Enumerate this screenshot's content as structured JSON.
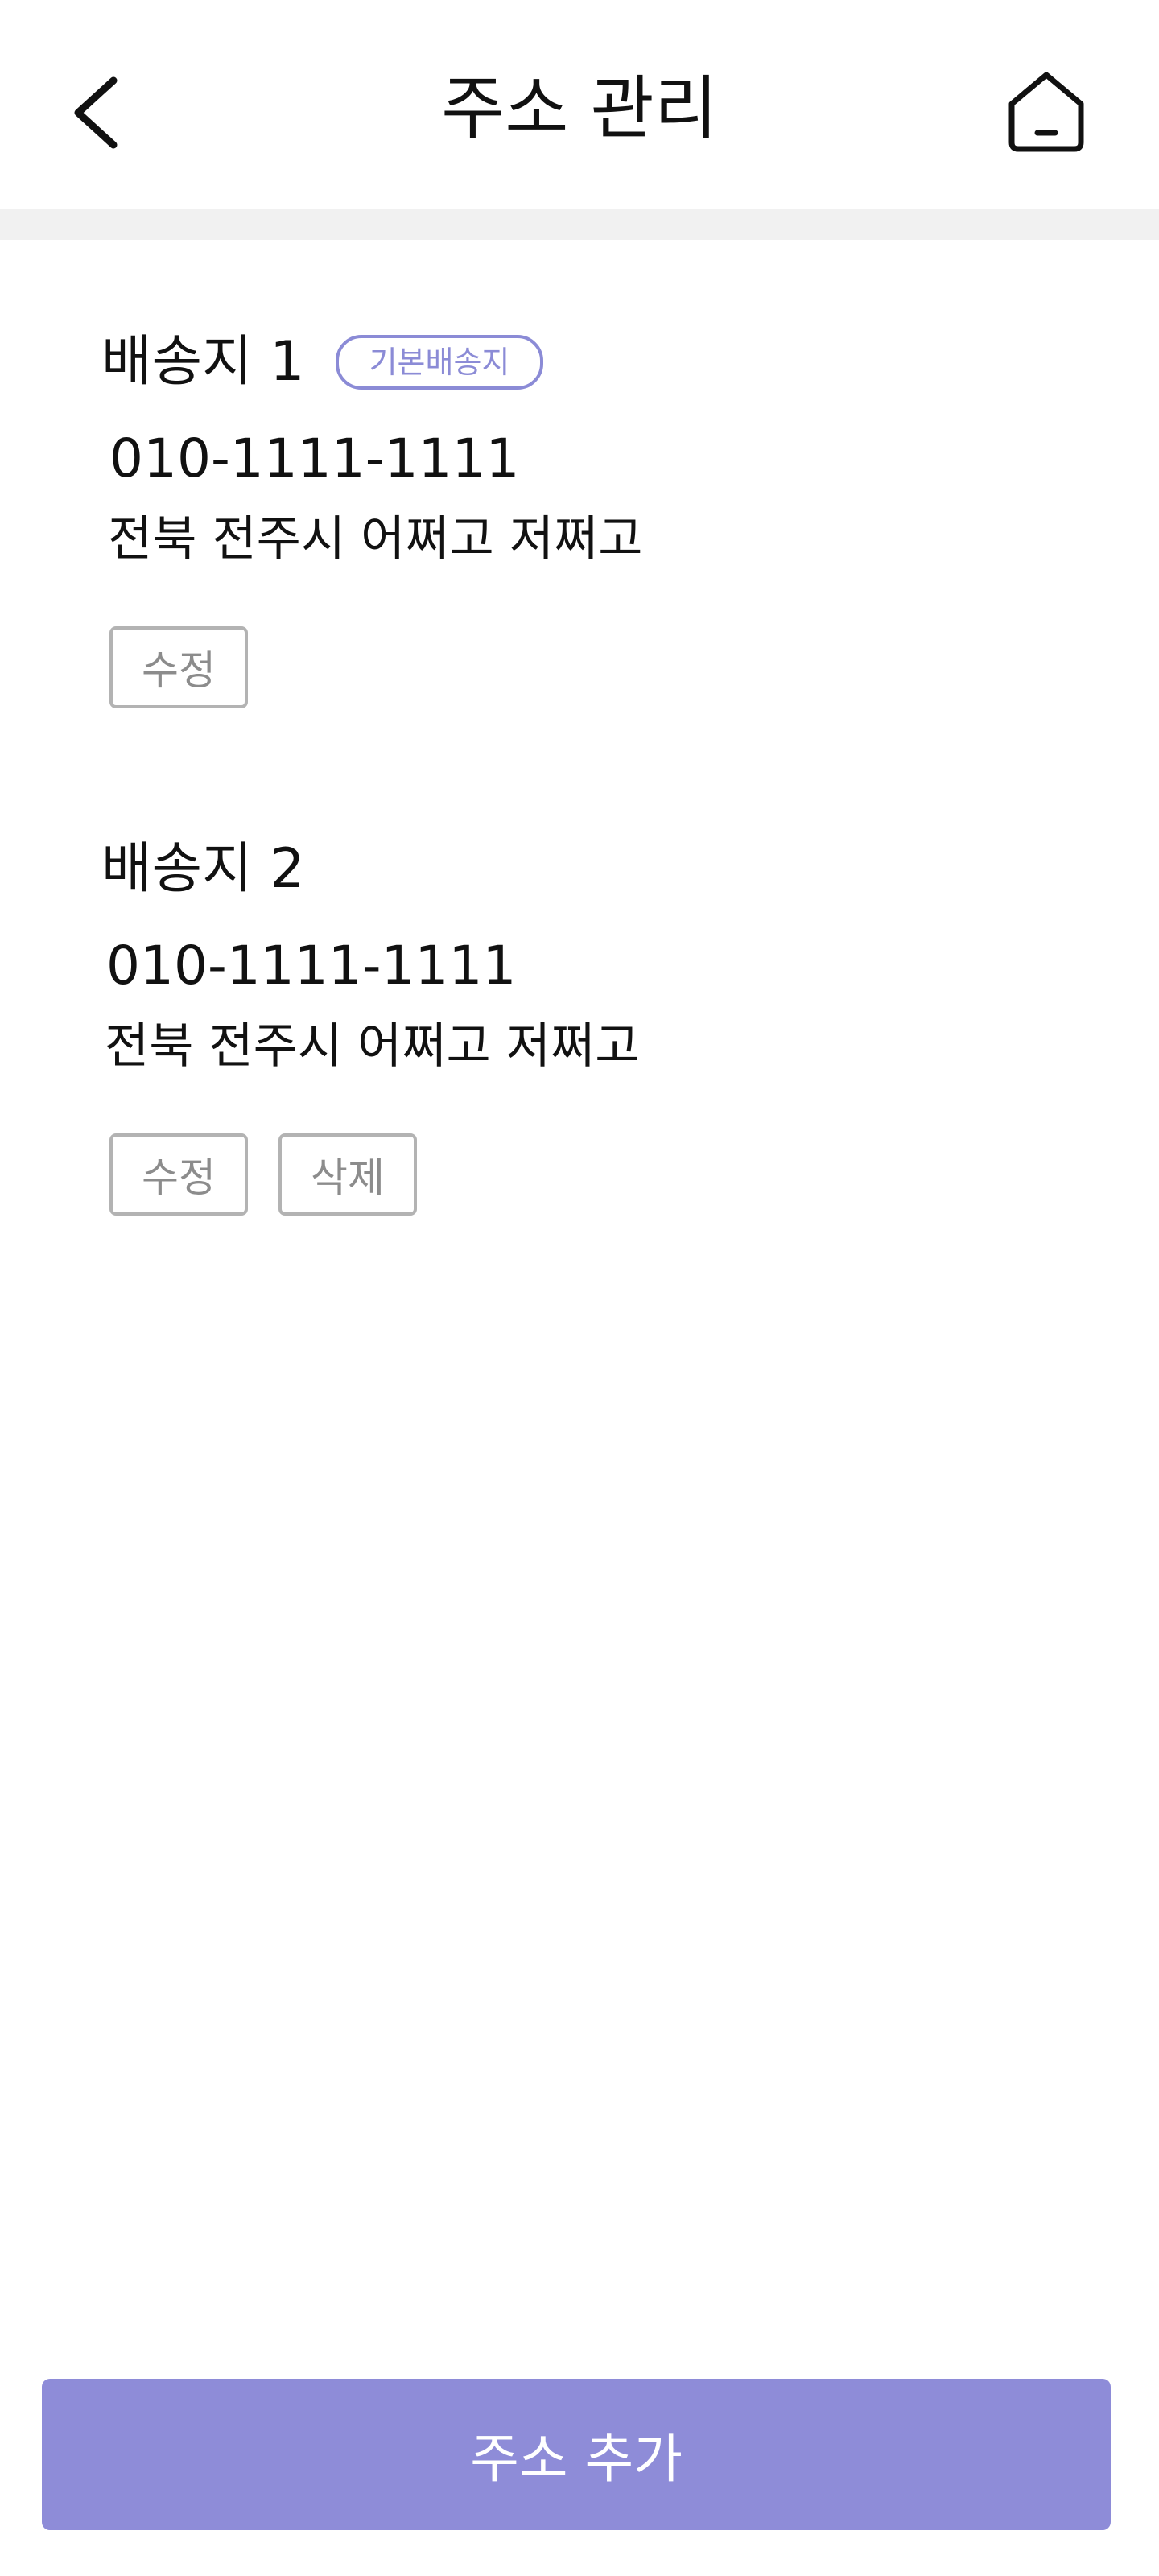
{
  "header": {
    "title": "주소 관리",
    "back_icon": "chevron-left-icon",
    "home_icon": "home-icon"
  },
  "addresses": [
    {
      "name": "배송지 1",
      "badge": "기본배송지",
      "phone": "010-1111-1111",
      "address": "전북 전주시 어쩌고 저쩌고",
      "edit_label": "수정"
    },
    {
      "name": "배송지 2",
      "phone": "010-1111-1111",
      "address": "전북 전주시 어쩌고 저쩌고",
      "edit_label": "수정",
      "delete_label": "삭제"
    }
  ],
  "footer": {
    "add_label": "주소 추가"
  },
  "colors": {
    "accent": "#8e8cd8",
    "badge": "#8b8bd6",
    "button_border": "#b3b3b3",
    "button_text": "#8c8c8c",
    "divider": "#f1f1f1"
  }
}
